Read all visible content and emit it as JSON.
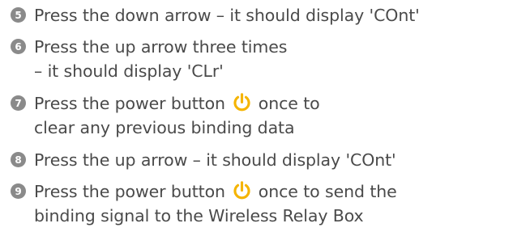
{
  "steps": [
    {
      "number": "5",
      "text": "Press the down arrow – it should display 'COnt'"
    },
    {
      "number": "6",
      "line1": "Press the up arrow three times",
      "line2": "– it should display 'CLr'"
    },
    {
      "number": "7",
      "before": "Press the power button",
      "after": "once to",
      "line2": "clear any previous binding data"
    },
    {
      "number": "8",
      "text": "Press the up arrow – it should display 'COnt'"
    },
    {
      "number": "9",
      "before": "Press the power button",
      "after": "once to send the",
      "line2": "binding signal to the Wireless Relay Box"
    }
  ],
  "icons": {
    "power": "power-icon",
    "power_color": "#f5b400",
    "bullet_color": "#8a8a8a"
  }
}
